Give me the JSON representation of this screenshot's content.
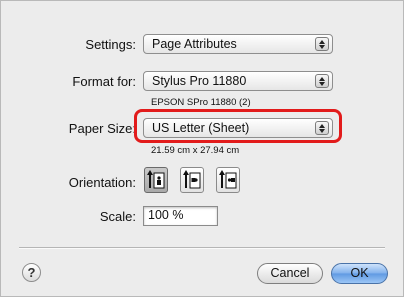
{
  "settings": {
    "label": "Settings:",
    "value": "Page Attributes"
  },
  "format_for": {
    "label": "Format for:",
    "value": "Stylus Pro 11880",
    "detail": "EPSON SPro 11880 (2)"
  },
  "paper_size": {
    "label": "Paper Size:",
    "value": "US Letter (Sheet)",
    "dimensions": "21.59 cm x 27.94 cm"
  },
  "orientation": {
    "label": "Orientation:",
    "options": [
      {
        "name": "portrait",
        "icon": "portrait-icon",
        "selected": true
      },
      {
        "name": "landscape-left",
        "icon": "landscape-left-icon",
        "selected": false
      },
      {
        "name": "landscape-right",
        "icon": "landscape-right-icon",
        "selected": false
      }
    ]
  },
  "scale": {
    "label": "Scale:",
    "value": "100 %"
  },
  "buttons": {
    "help": "?",
    "cancel": "Cancel",
    "ok": "OK"
  },
  "colors": {
    "highlight": "#e21b1b",
    "default_button": "#6fa3e6"
  }
}
